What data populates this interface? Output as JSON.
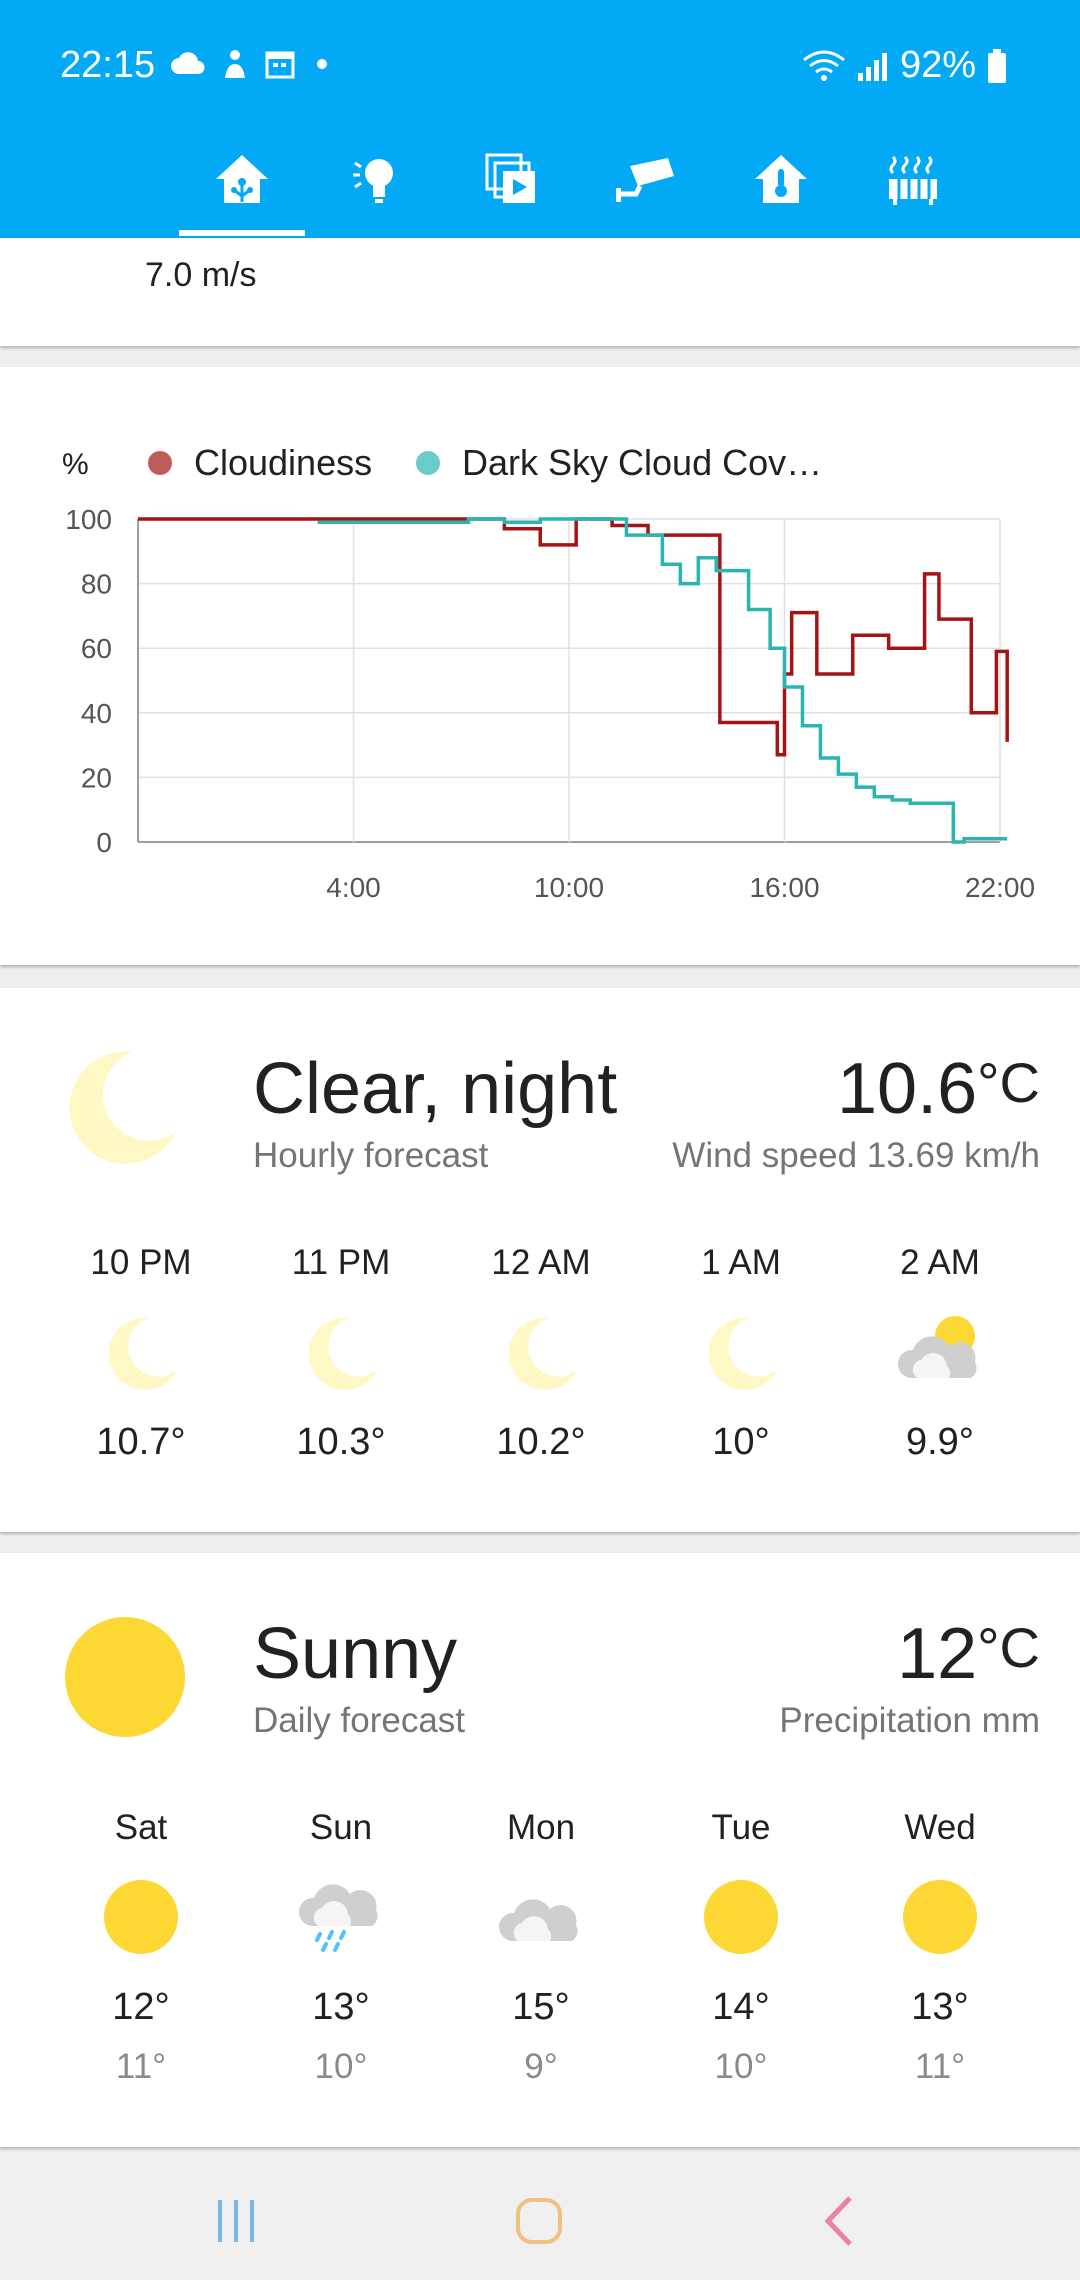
{
  "status_bar": {
    "time": "22:15",
    "battery": "92%",
    "icons": [
      "cloud-icon",
      "person-icon",
      "calendar-icon",
      "dot-icon",
      "wifi-icon",
      "signal-icon",
      "battery-icon"
    ]
  },
  "tabs": {
    "items": [
      "home-icon",
      "lightbulb-icon",
      "media-icon",
      "camera-icon",
      "thermometer-home-icon",
      "radiator-icon"
    ],
    "selected_index": 0
  },
  "wind_card": {
    "value": "7.0 m/s"
  },
  "chart_data": {
    "type": "line",
    "ylabel": "%",
    "ylim": [
      0,
      100
    ],
    "y_ticks": [
      "100",
      "80",
      "60",
      "40",
      "20",
      "0"
    ],
    "x_ticks": [
      "4:00",
      "10:00",
      "16:00",
      "22:00"
    ],
    "legend": "top",
    "grid": true,
    "series": [
      {
        "name": "Cloudiness",
        "color": "#a31515",
        "step": true,
        "x": [
          22.1,
          4,
          7.2,
          8.2,
          9.2,
          10.2,
          11.2,
          12.2,
          14.2,
          15.8,
          16.0,
          16.2,
          16.9,
          17.9,
          18.9,
          19.9,
          20.3,
          21.2,
          21.9,
          22.2
        ],
        "y": [
          100,
          100,
          100,
          97,
          92,
          100,
          98,
          95,
          37,
          27,
          52,
          71,
          52,
          64,
          60,
          83,
          69,
          40,
          59,
          31
        ]
      },
      {
        "name": "Dark Sky Cloud Cov…",
        "color": "#2bb5b0",
        "step": true,
        "x": [
          3,
          6.6,
          7.2,
          8.2,
          9.2,
          10.2,
          11.6,
          12.6,
          13.1,
          13.6,
          14.1,
          15.0,
          15.6,
          16.0,
          16.5,
          17.0,
          17.5,
          18.0,
          18.5,
          19.0,
          19.5,
          20.0,
          20.7,
          21.0,
          22.2
        ],
        "y": [
          99,
          99,
          100,
          99,
          100,
          100,
          95,
          86,
          80,
          88,
          84,
          72,
          60,
          48,
          36,
          26,
          21,
          17,
          14,
          13,
          12,
          12,
          0,
          1,
          1
        ]
      }
    ]
  },
  "hourly_card": {
    "condition": "Clear, night",
    "subtitle": "Hourly forecast",
    "temp": "10.6",
    "unit": "°C",
    "extra": "Wind speed 13.69 km/h",
    "forecast": [
      {
        "time": "10 PM",
        "icon": "moon-icon",
        "temp": "10.7°"
      },
      {
        "time": "11 PM",
        "icon": "moon-icon",
        "temp": "10.3°"
      },
      {
        "time": "12 AM",
        "icon": "moon-icon",
        "temp": "10.2°"
      },
      {
        "time": "1 AM",
        "icon": "moon-icon",
        "temp": "10°"
      },
      {
        "time": "2 AM",
        "icon": "partly-cloudy-icon",
        "temp": "9.9°"
      }
    ]
  },
  "daily_card": {
    "condition": "Sunny",
    "subtitle": "Daily forecast",
    "temp": "12",
    "unit": "°C",
    "extra": "Precipitation mm",
    "forecast": [
      {
        "day": "Sat",
        "icon": "sun-icon",
        "high": "12°",
        "low": "11°"
      },
      {
        "day": "Sun",
        "icon": "rain-cloud-icon",
        "high": "13°",
        "low": "10°"
      },
      {
        "day": "Mon",
        "icon": "cloud-icon",
        "high": "15°",
        "low": "9°"
      },
      {
        "day": "Tue",
        "icon": "sun-icon",
        "high": "14°",
        "low": "10°"
      },
      {
        "day": "Wed",
        "icon": "sun-icon",
        "high": "13°",
        "low": "11°"
      }
    ]
  },
  "colors": {
    "header": "#03a9f4",
    "sun": "#fdd835",
    "moon": "#fff7c4",
    "cloudiness": "#a31515",
    "dark_sky": "#2bb5b0"
  }
}
